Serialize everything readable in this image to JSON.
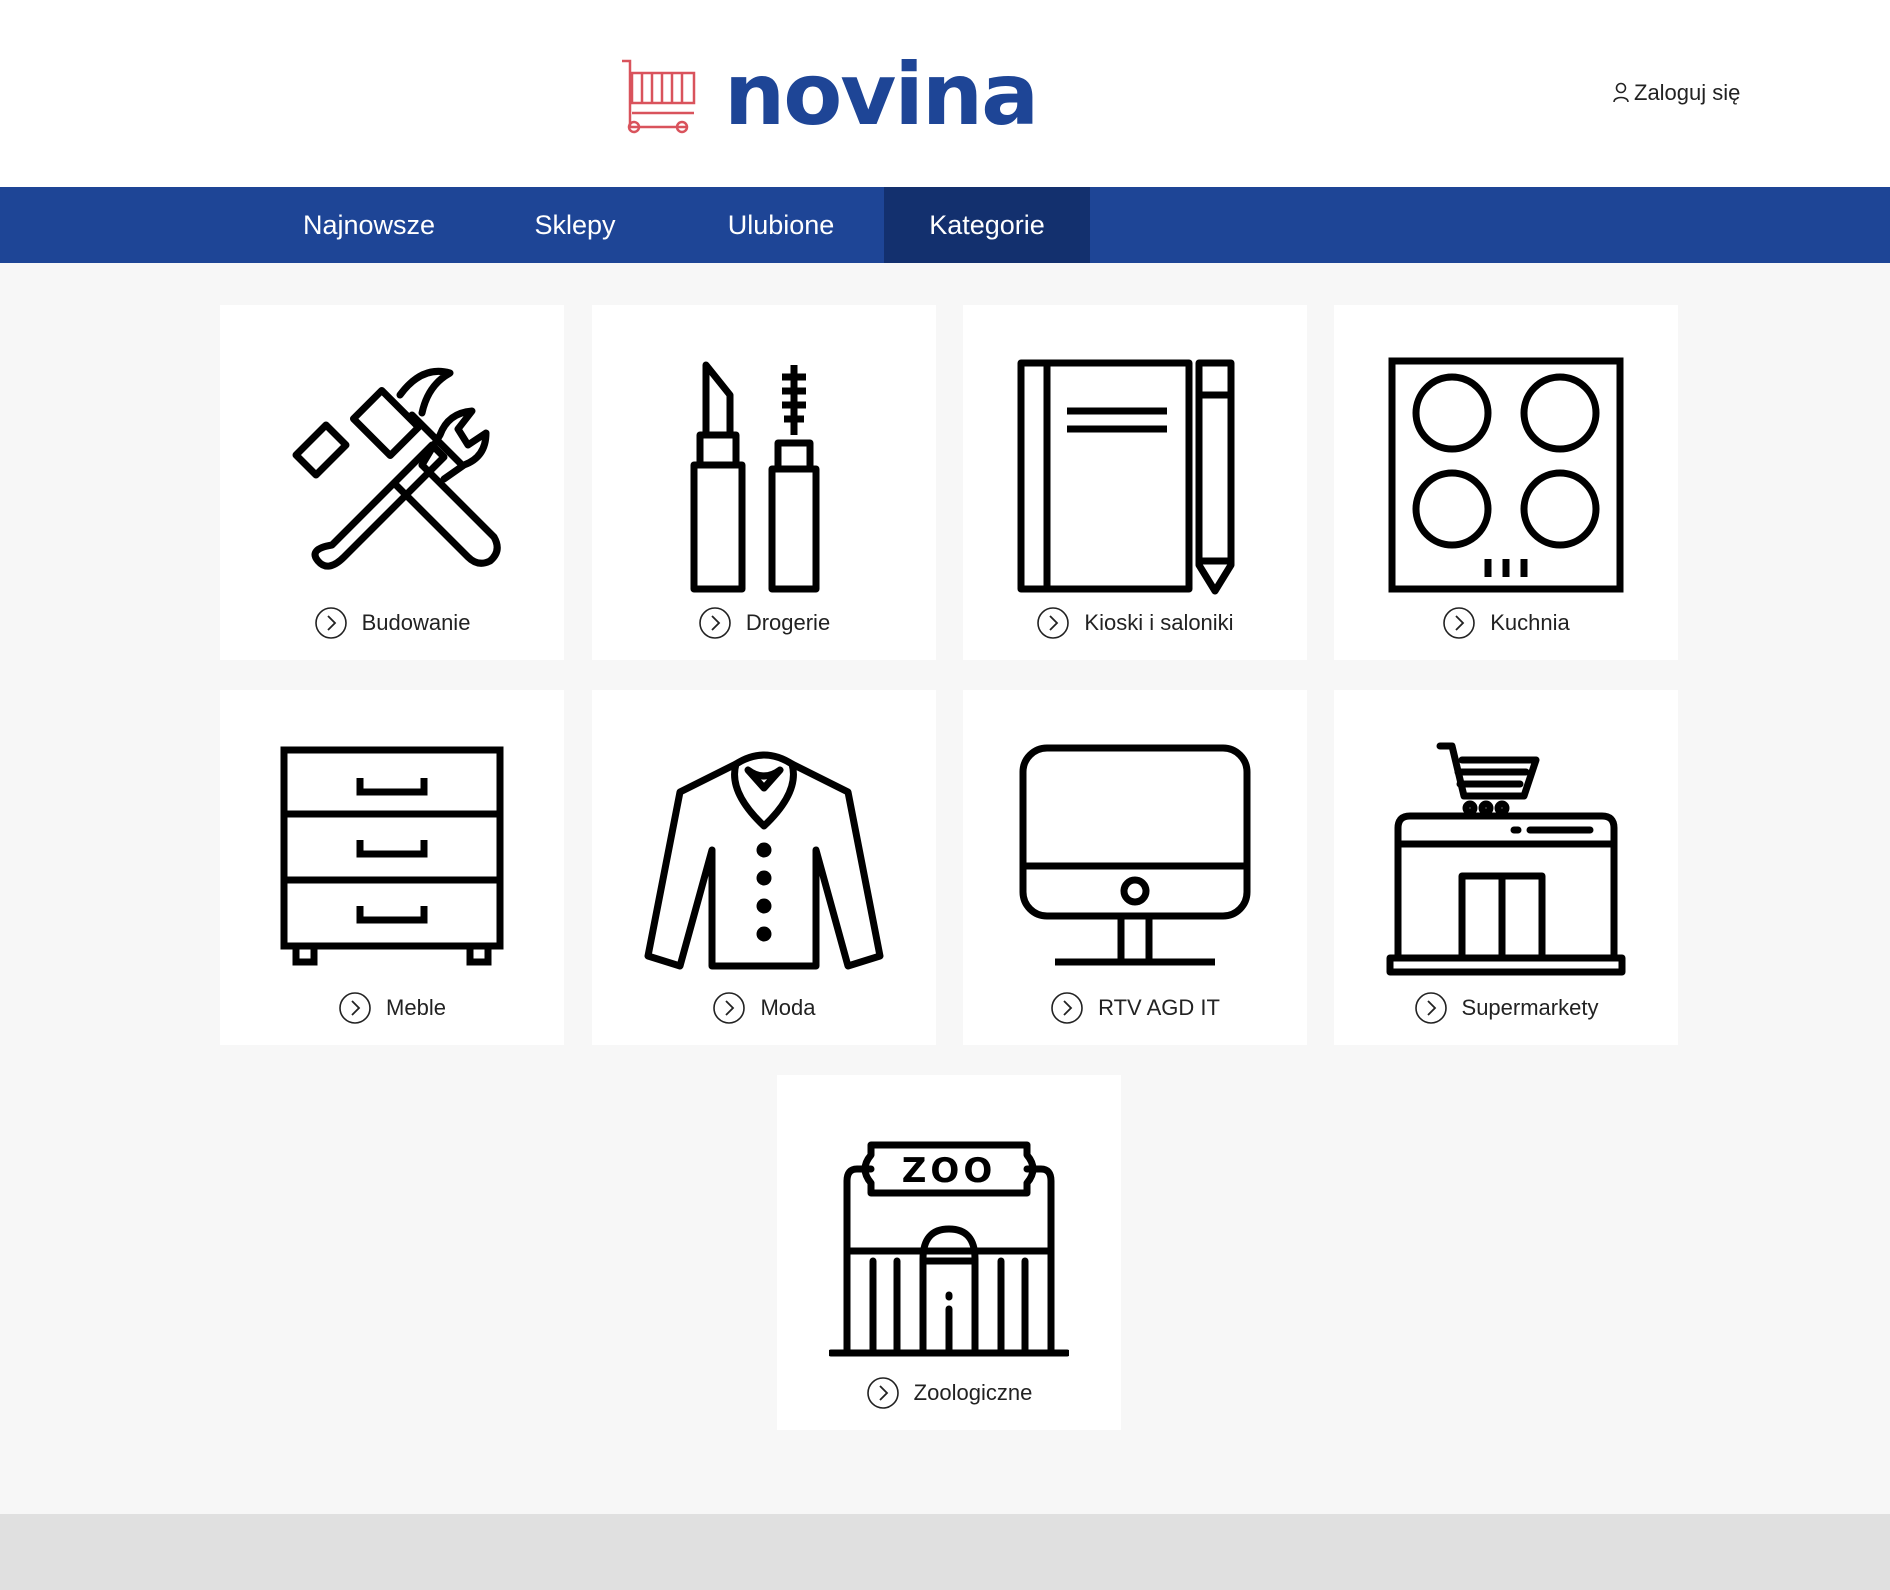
{
  "header": {
    "logo_text": "novina",
    "logo_icon": "shopping-cart-icon",
    "login_label": "Zaloguj się",
    "login_icon": "user-icon"
  },
  "nav": {
    "tabs": [
      {
        "label": "Najnowsze",
        "active": false
      },
      {
        "label": "Sklepy",
        "active": false
      },
      {
        "label": "Ulubione",
        "active": false
      },
      {
        "label": "Kategorie",
        "active": true
      }
    ]
  },
  "categories": [
    {
      "label": "Budowanie",
      "icon": "hammer-wrench-icon"
    },
    {
      "label": "Drogerie",
      "icon": "lipstick-mascara-icon"
    },
    {
      "label": "Kioski i saloniki",
      "icon": "notebook-pencil-icon"
    },
    {
      "label": "Kuchnia",
      "icon": "cooktop-icon"
    },
    {
      "label": "Meble",
      "icon": "dresser-icon"
    },
    {
      "label": "Moda",
      "icon": "shirt-icon"
    },
    {
      "label": "RTV AGD IT",
      "icon": "monitor-icon"
    },
    {
      "label": "Supermarkety",
      "icon": "supermarket-icon"
    },
    {
      "label": "Zoologiczne",
      "icon": "zoo-icon"
    }
  ],
  "category_action_icon": "chevron-right-circle-icon",
  "colors": {
    "brand_blue": "#1e4596",
    "active_tab": "#13306e",
    "logo_cart": "#d9535c",
    "page_bg": "#f7f7f7",
    "footer_bg": "#e0e0e0"
  }
}
